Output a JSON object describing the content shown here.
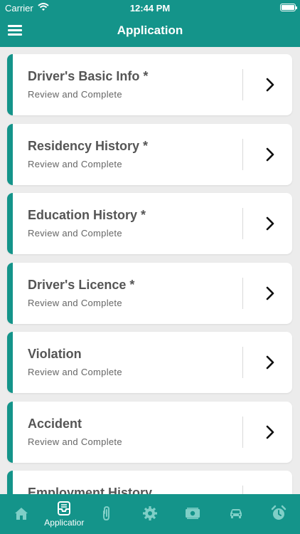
{
  "status_bar": {
    "carrier": "Carrier",
    "time": "12:44 PM"
  },
  "header": {
    "title": "Application",
    "menu_icon": "hamburger-menu-icon"
  },
  "sections": [
    {
      "title": "Driver's Basic Info *",
      "subtitle": "Review and Complete"
    },
    {
      "title": "Residency History *",
      "subtitle": "Review and Complete"
    },
    {
      "title": "Education History *",
      "subtitle": "Review and Complete"
    },
    {
      "title": "Driver's Licence *",
      "subtitle": "Review and Complete"
    },
    {
      "title": "Violation",
      "subtitle": "Review and Complete"
    },
    {
      "title": "Accident",
      "subtitle": "Review and Complete"
    },
    {
      "title": "Employment History",
      "subtitle": ""
    }
  ],
  "tabs": [
    {
      "icon": "home-icon",
      "label": "",
      "active": false
    },
    {
      "icon": "inbox-tray-icon",
      "label": "Applicatior",
      "active": true
    },
    {
      "icon": "paperclip-icon",
      "label": "",
      "active": false
    },
    {
      "icon": "gear-icon",
      "label": "",
      "active": false
    },
    {
      "icon": "money-icon",
      "label": "",
      "active": false
    },
    {
      "icon": "car-icon",
      "label": "",
      "active": false
    },
    {
      "icon": "alarm-clock-icon",
      "label": "",
      "active": false
    }
  ],
  "colors": {
    "primary": "#14948a",
    "background": "#ececec",
    "card": "#ffffff",
    "title_text": "#555555",
    "subtitle_text": "#666666",
    "inactive_tab_icon": "#7fcfc7"
  }
}
